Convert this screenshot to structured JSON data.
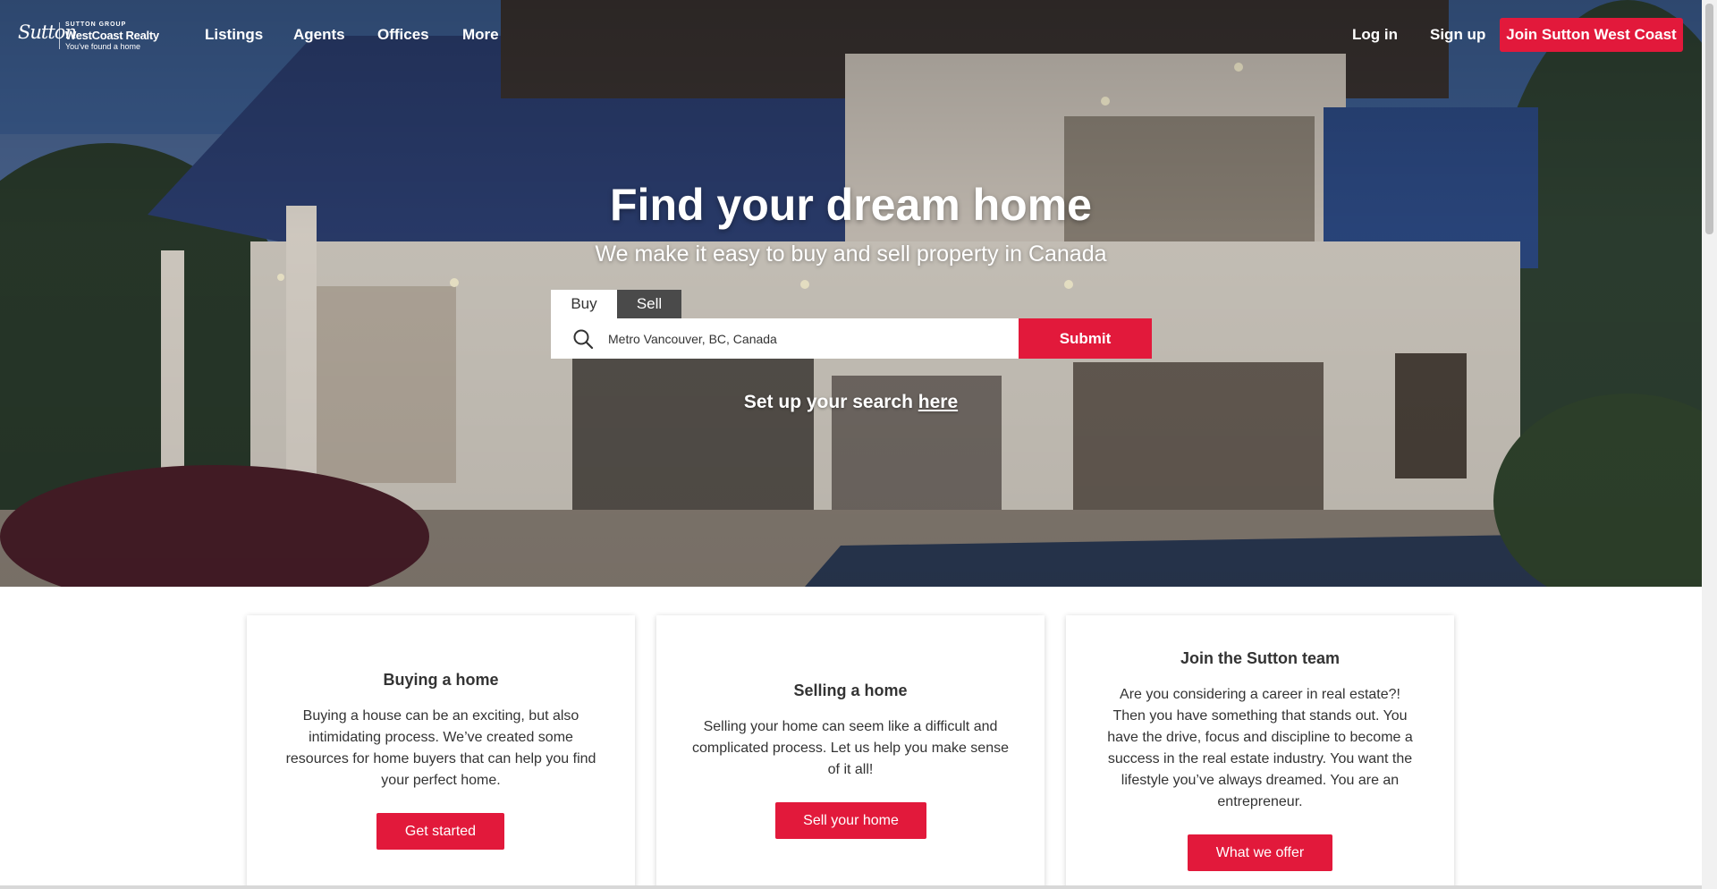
{
  "nav": {
    "logo": {
      "script": "Sutton",
      "group": "SUTTON GROUP",
      "brand": "WestCoast Realty",
      "tagline": "You've found a home"
    },
    "links": [
      "Listings",
      "Agents",
      "Offices",
      "More"
    ],
    "login": "Log in",
    "signup": "Sign up",
    "join": "Join Sutton West Coast"
  },
  "hero": {
    "title": "Find your dream home",
    "subtitle": "We make it easy to buy and sell property in Canada",
    "tabs": [
      "Buy",
      "Sell"
    ],
    "search": {
      "value": "Metro Vancouver, BC, Canada",
      "icon": "search-icon"
    },
    "submit": "Submit",
    "setup_prefix": "Set up your search ",
    "setup_link": "here"
  },
  "cards": [
    {
      "title": "Buying a home",
      "body": "Buying a house can be an exciting, but also intimidating process. We’ve created some resources for home buyers that can help you find your perfect home.",
      "button": "Get started"
    },
    {
      "title": "Selling a home",
      "body": "Selling your home can seem like a difficult and complicated process. Let us help you make sense of it all!",
      "button": "Sell your home"
    },
    {
      "title": "Join the Sutton team",
      "body": "Are you considering a career in real estate?! Then you have something that stands out. You have the drive, focus and discipline to become a success in the real estate industry. You want the lifestyle you’ve always dreamed. You are an entrepreneur.",
      "button": "What we offer"
    }
  ],
  "colors": {
    "accent": "#e2193b",
    "text": "#333333",
    "tab_dark": "#4a4a4a"
  }
}
